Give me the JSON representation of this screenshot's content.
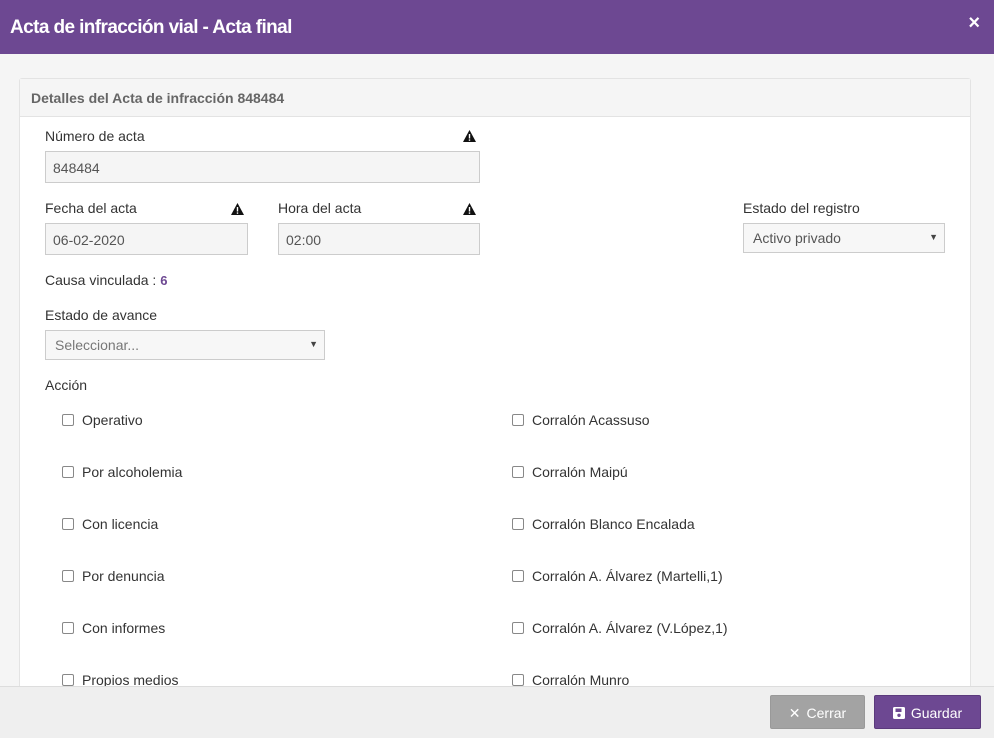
{
  "header": {
    "title": "Acta de infracción vial - Acta final",
    "close_icon": "×"
  },
  "panel": {
    "title": "Detalles del Acta de infracción 848484"
  },
  "numero": {
    "label": "Número de acta",
    "value": "848484"
  },
  "fecha": {
    "label": "Fecha del acta",
    "value": "06-02-2020"
  },
  "hora": {
    "label": "Hora del acta",
    "value": "02:00"
  },
  "estado_registro": {
    "label": "Estado del registro",
    "selected": "Activo privado"
  },
  "causa": {
    "label": "Causa vinculada :",
    "value": "6"
  },
  "estado_avance": {
    "label": "Estado de avance",
    "selected": "Seleccionar..."
  },
  "accion": {
    "label": "Acción",
    "left": [
      "Operativo",
      "Por alcoholemia",
      "Con licencia",
      "Por denuncia",
      "Con informes",
      "Propios medios"
    ],
    "right": [
      "Corralón Acassuso",
      "Corralón Maipú",
      "Corralón Blanco Encalada",
      "Corralón A. Álvarez (Martelli,1)",
      "Corralón A. Álvarez (V.López,1)",
      "Corralón Munro"
    ]
  },
  "footer": {
    "cerrar_label": "Cerrar",
    "guardar_label": "Guardar"
  },
  "colors": {
    "brand": "#6d4892",
    "link": "#6d4892",
    "secondary_button": "#a3a3a3"
  },
  "icons": {
    "warning": "warning-icon",
    "close": "close-icon",
    "save": "save-icon",
    "caret": "caret-down-icon"
  }
}
